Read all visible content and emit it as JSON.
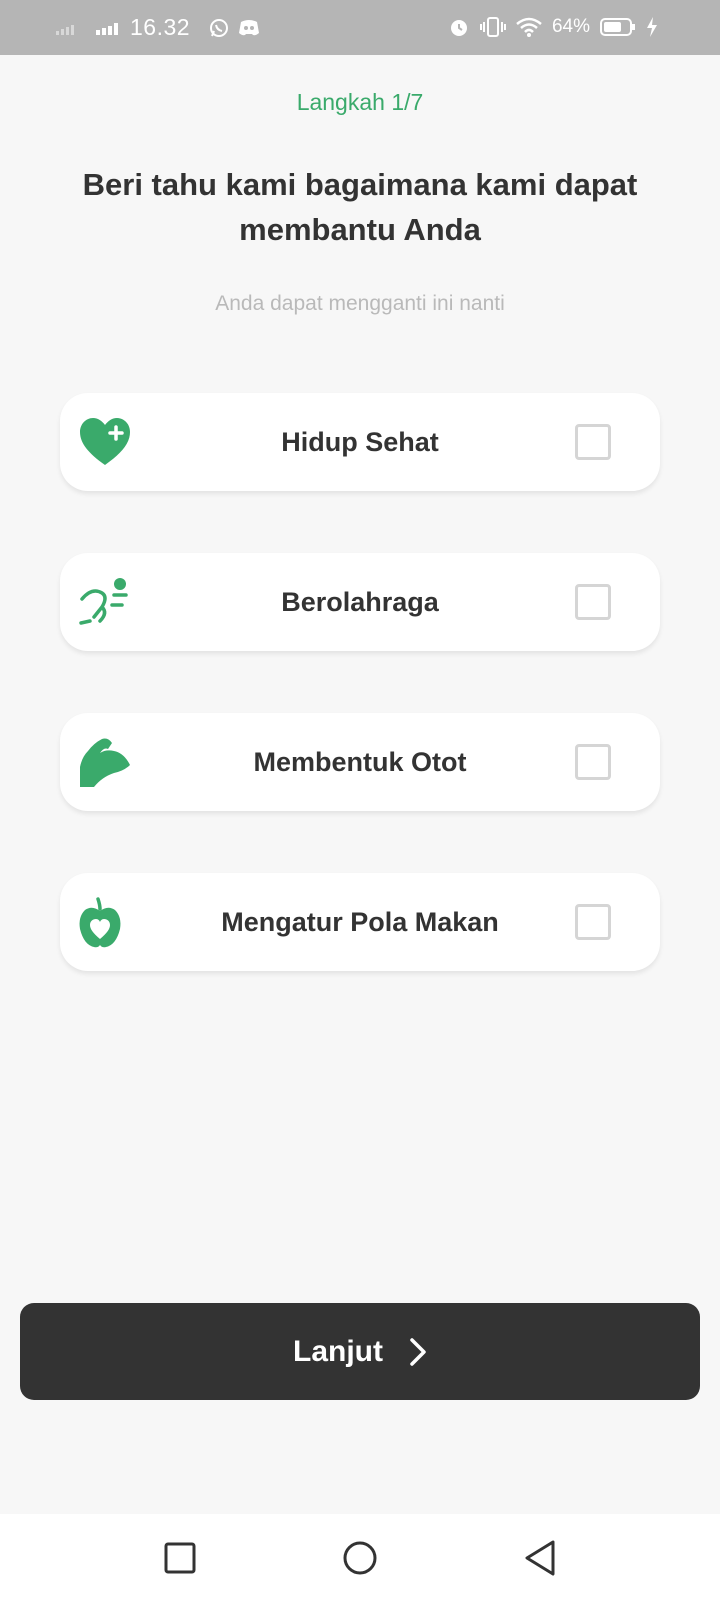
{
  "status_bar": {
    "time": "16.32",
    "battery": "64%",
    "icons": [
      "signal-icon",
      "signal-icon",
      "whatsapp-icon",
      "discord-icon",
      "alarm-icon",
      "vibrate-icon",
      "wifi-icon",
      "battery-icon",
      "charging-icon"
    ]
  },
  "header": {
    "step": "Langkah 1/7",
    "title": "Beri tahu kami bagaimana kami dapat membantu Anda",
    "subtitle": "Anda dapat mengganti ini nanti"
  },
  "options": [
    {
      "label": "Hidup Sehat",
      "icon": "heart-plus-icon",
      "checked": false
    },
    {
      "label": "Berolahraga",
      "icon": "running-icon",
      "checked": false
    },
    {
      "label": "Membentuk Otot",
      "icon": "muscle-icon",
      "checked": false
    },
    {
      "label": "Mengatur Pola Makan",
      "icon": "apple-heart-icon",
      "checked": false
    }
  ],
  "next_button": {
    "label": "Lanjut",
    "icon": "chevron-right-icon"
  },
  "nav": {
    "icons": [
      "recent-apps-icon",
      "home-icon",
      "back-icon"
    ]
  },
  "colors": {
    "accent": "#3aaa6b",
    "button": "#333333",
    "background": "#f7f7f7",
    "status_bar": "#b5b5b5"
  }
}
